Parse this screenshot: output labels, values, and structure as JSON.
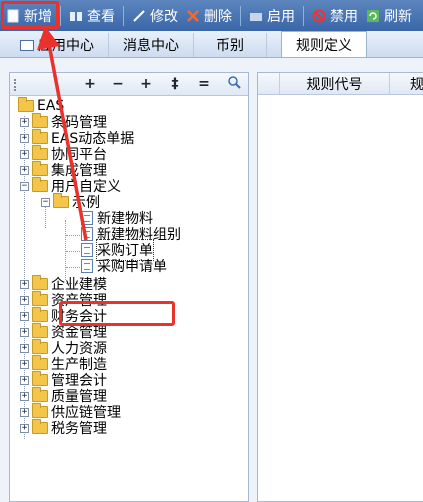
{
  "toolbar": {
    "new_label": "新增",
    "view_label": "查看",
    "edit_label": "修改",
    "delete_label": "删除",
    "enable_label": "启用",
    "disable_label": "禁用",
    "refresh_label": "刷新"
  },
  "tabs": [
    {
      "label": "应用中心"
    },
    {
      "label": "消息中心"
    },
    {
      "label": "币别"
    },
    {
      "label": "规则定义"
    }
  ],
  "tree_tools": [
    "+",
    "−",
    "+",
    "‡",
    "=",
    "search-icon"
  ],
  "tree": {
    "root": "EAS",
    "items": [
      {
        "label": "条码管理"
      },
      {
        "label": "EAS动态单据"
      },
      {
        "label": "协同平台"
      },
      {
        "label": "集成管理"
      },
      {
        "label": "用户自定义"
      },
      {
        "label": "示例"
      },
      {
        "label": "新建物料"
      },
      {
        "label": "新建物料组别"
      },
      {
        "label": "采购订单"
      },
      {
        "label": "采购申请单"
      },
      {
        "label": "企业建模"
      },
      {
        "label": "资产管理"
      },
      {
        "label": "财务会计"
      },
      {
        "label": "资金管理"
      },
      {
        "label": "人力资源"
      },
      {
        "label": "生产制造"
      },
      {
        "label": "管理会计"
      },
      {
        "label": "质量管理"
      },
      {
        "label": "供应链管理"
      },
      {
        "label": "税务管理"
      }
    ]
  },
  "grid": {
    "col1": "规则代号",
    "col2": "规则"
  },
  "colors": {
    "toolbar": "#3a66a8",
    "highlight": "#e8322b",
    "folder": "#f3c54b"
  }
}
